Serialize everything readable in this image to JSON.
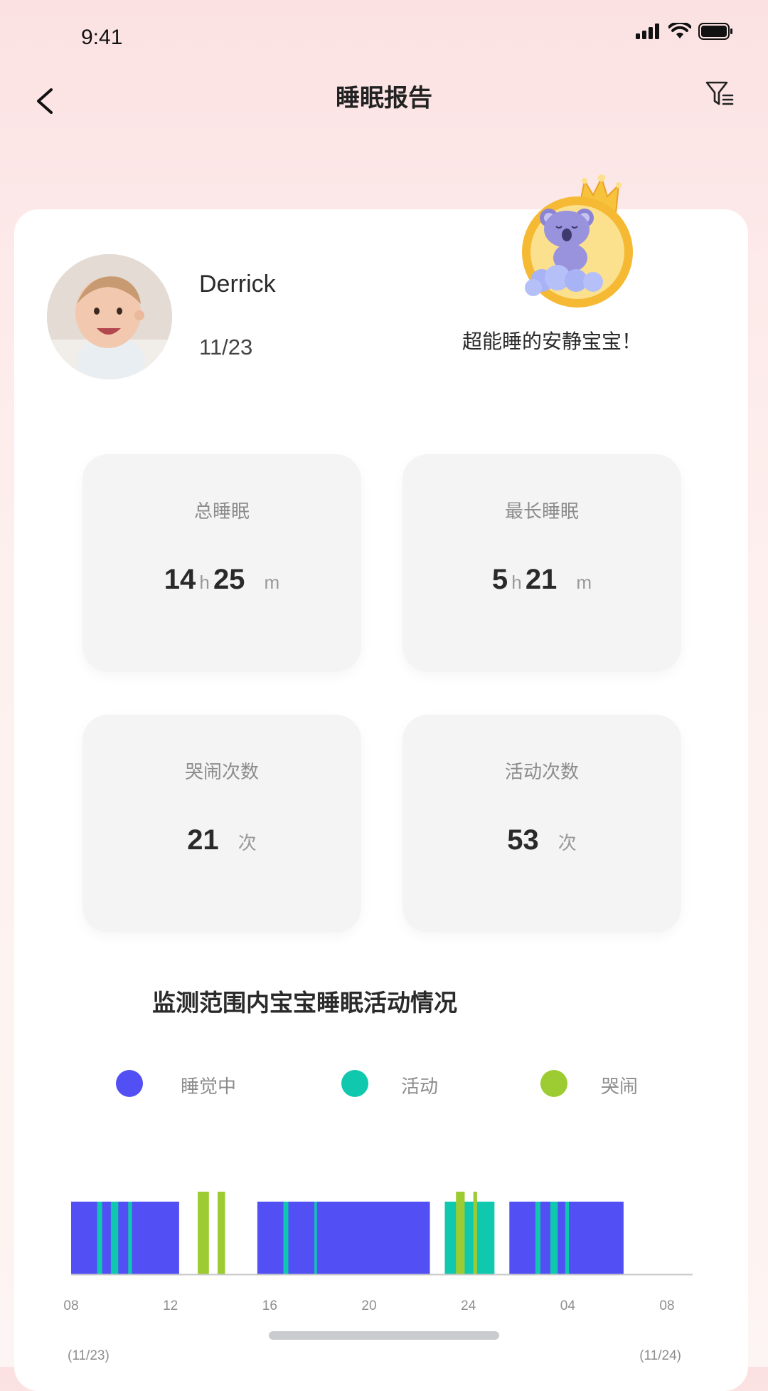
{
  "status_bar": {
    "time": "9:41"
  },
  "header": {
    "title": "睡眠报告"
  },
  "profile": {
    "name": "Derrick",
    "date": "11/23",
    "badge_text": "超能睡的安静宝宝！"
  },
  "stats": {
    "total_sleep": {
      "label": "总睡眠",
      "hours": "14",
      "hours_unit": "h",
      "minutes": "25",
      "minutes_unit": "m"
    },
    "longest_sleep": {
      "label": "最长睡眠",
      "hours": "5",
      "hours_unit": "h",
      "minutes": "21",
      "minutes_unit": "m"
    },
    "cry_count": {
      "label": "哭闹次数",
      "value": "21",
      "unit": "次"
    },
    "activity_count": {
      "label": "活动次数",
      "value": "53",
      "unit": "次"
    }
  },
  "chart_section": {
    "title": "监测范围内宝宝睡眠活动情况",
    "legend": [
      {
        "label": "睡觉中",
        "color": "#5250f5"
      },
      {
        "label": "活动",
        "color": "#0fc8ae"
      },
      {
        "label": "哭闹",
        "color": "#9ccc32"
      }
    ]
  },
  "chart_data": {
    "type": "timeline",
    "x_unit": "hours since 08:00 on 11/23",
    "xlim": [
      0,
      24
    ],
    "tick_labels": [
      "08",
      "12",
      "16",
      "20",
      "24",
      "04",
      "08"
    ],
    "tick_positions": [
      0,
      4,
      8,
      12,
      16,
      20,
      24
    ],
    "date_labels": [
      "(11/23)",
      "(11/24)"
    ],
    "segments": [
      {
        "state": "睡觉中",
        "start": 0.0,
        "end": 4.35
      },
      {
        "state": "活动",
        "start": 1.05,
        "end": 1.25
      },
      {
        "state": "活动",
        "start": 1.6,
        "end": 1.9
      },
      {
        "state": "活动",
        "start": 2.3,
        "end": 2.45
      },
      {
        "state": "哭闹",
        "start": 5.1,
        "end": 5.55
      },
      {
        "state": "哭闹",
        "start": 5.9,
        "end": 6.2
      },
      {
        "state": "睡觉中",
        "start": 7.5,
        "end": 14.45
      },
      {
        "state": "活动",
        "start": 8.55,
        "end": 8.75
      },
      {
        "state": "活动",
        "start": 9.8,
        "end": 9.9
      },
      {
        "state": "活动",
        "start": 15.05,
        "end": 17.05
      },
      {
        "state": "哭闹",
        "start": 15.5,
        "end": 15.85
      },
      {
        "state": "哭闹",
        "start": 16.2,
        "end": 16.35
      },
      {
        "state": "睡觉中",
        "start": 17.65,
        "end": 22.25
      },
      {
        "state": "活动",
        "start": 18.7,
        "end": 18.9
      },
      {
        "state": "活动",
        "start": 19.3,
        "end": 19.6
      },
      {
        "state": "活动",
        "start": 19.9,
        "end": 20.05
      }
    ]
  },
  "colors": {
    "sleep": "#5250f5",
    "activity": "#0fc8ae",
    "crying": "#9ccc32"
  }
}
